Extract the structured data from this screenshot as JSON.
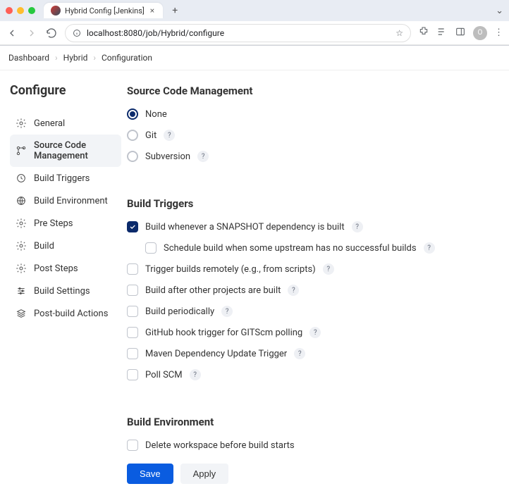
{
  "browser": {
    "tab_title": "Hybrid Config [Jenkins]",
    "url": "localhost:8080/job/Hybrid/configure"
  },
  "breadcrumbs": {
    "items": [
      "Dashboard",
      "Hybrid",
      "Configuration"
    ]
  },
  "page_title": "Configure",
  "sidebar": {
    "items": [
      {
        "label": "General"
      },
      {
        "label": "Source Code Management"
      },
      {
        "label": "Build Triggers"
      },
      {
        "label": "Build Environment"
      },
      {
        "label": "Pre Steps"
      },
      {
        "label": "Build"
      },
      {
        "label": "Post Steps"
      },
      {
        "label": "Build Settings"
      },
      {
        "label": "Post-build Actions"
      }
    ],
    "active_index": 1
  },
  "sections": {
    "scm": {
      "title": "Source Code Management",
      "options": {
        "none": "None",
        "git": "Git",
        "svn": "Subversion"
      },
      "selected": "none"
    },
    "triggers": {
      "title": "Build Triggers",
      "items": {
        "snapshot": {
          "label": "Build whenever a SNAPSHOT dependency is built",
          "checked": true
        },
        "schedule_upstream": {
          "label": "Schedule build when some upstream has no successful builds",
          "checked": false
        },
        "remote": {
          "label": "Trigger builds remotely (e.g., from scripts)",
          "checked": false
        },
        "after_others": {
          "label": "Build after other projects are built",
          "checked": false
        },
        "periodic": {
          "label": "Build periodically",
          "checked": false
        },
        "github": {
          "label": "GitHub hook trigger for GITScm polling",
          "checked": false
        },
        "maven": {
          "label": "Maven Dependency Update Trigger",
          "checked": false
        },
        "poll": {
          "label": "Poll SCM",
          "checked": false
        }
      }
    },
    "env": {
      "title": "Build Environment",
      "items": {
        "delete_ws": {
          "label": "Delete workspace before build starts",
          "checked": false
        }
      }
    }
  },
  "buttons": {
    "save": "Save",
    "apply": "Apply"
  }
}
